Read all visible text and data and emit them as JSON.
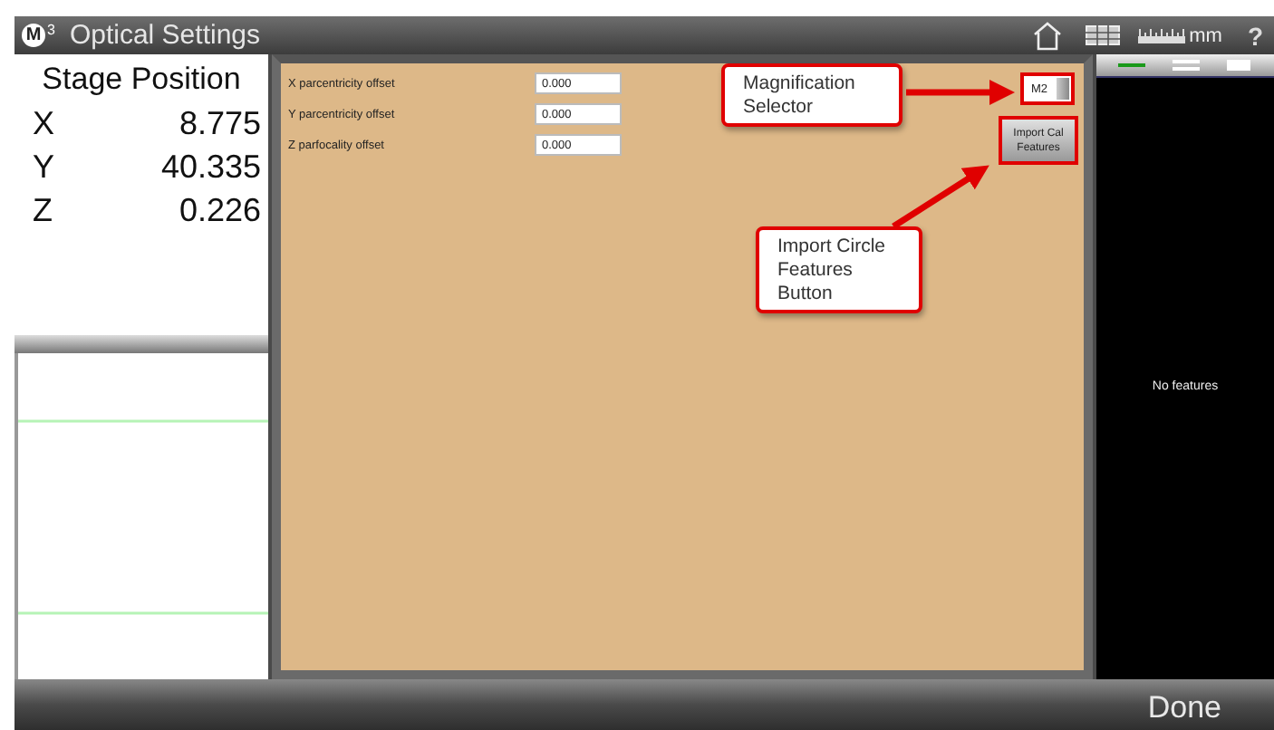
{
  "window": {
    "logo": {
      "letter": "M",
      "exponent": "3"
    },
    "title": "Optical Settings"
  },
  "toolbar": {
    "units": "mm",
    "help": "?"
  },
  "stage_position": {
    "title": "Stage Position",
    "axes": [
      {
        "axis": "X",
        "value": "8.775"
      },
      {
        "axis": "Y",
        "value": "40.335"
      },
      {
        "axis": "Z",
        "value": "0.226"
      }
    ]
  },
  "settings": [
    {
      "label": "X parcentricity offset",
      "value": "0.000"
    },
    {
      "label": "Y parcentricity offset",
      "value": "0.000"
    },
    {
      "label": "Z parfocality offset",
      "value": "0.000"
    }
  ],
  "magnification_selector": {
    "value": "M2"
  },
  "import_button": {
    "label": "Import Cal Features"
  },
  "callouts": [
    {
      "text": "Magnification Selector"
    },
    {
      "text": "Import Circle Features Button"
    }
  ],
  "features_panel": {
    "view_tabs": [
      {
        "kind": "line",
        "selected": true
      },
      {
        "kind": "double",
        "selected": false
      },
      {
        "kind": "block",
        "selected": false
      }
    ],
    "message": "No features"
  },
  "done_button": "Done"
}
